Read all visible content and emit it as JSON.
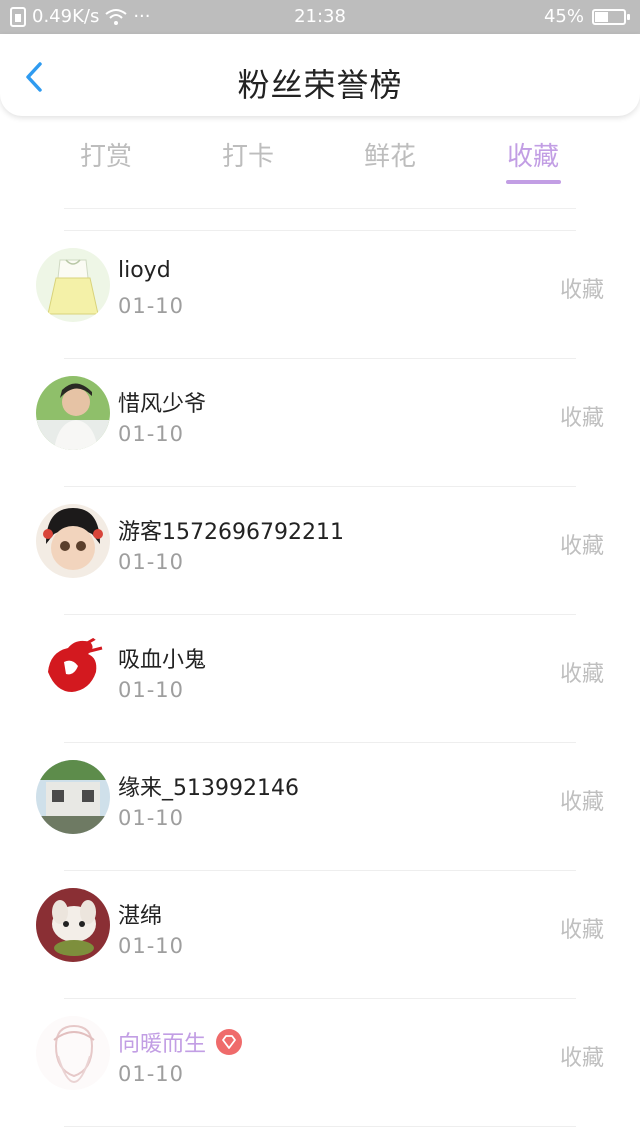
{
  "status_bar": {
    "network": "0.49K/s",
    "dots": "···",
    "time": "21:38",
    "battery": "45%",
    "battery_level": 0.45
  },
  "header": {
    "title": "粉丝荣誉榜"
  },
  "tabs": [
    {
      "label": "打赏"
    },
    {
      "label": "打卡"
    },
    {
      "label": "鲜花"
    },
    {
      "label": "收藏"
    }
  ],
  "active_tab": "收藏",
  "fans": [
    {
      "name": "lioyd",
      "date": "01-10",
      "action": "收藏"
    },
    {
      "name": "惜风少爷",
      "date": "01-10",
      "action": "收藏"
    },
    {
      "name": "游客1572696792211",
      "date": "01-10",
      "action": "收藏"
    },
    {
      "name": "吸血小鬼",
      "date": "01-10",
      "action": "收藏"
    },
    {
      "name": "缘来_513992146",
      "date": "01-10",
      "action": "收藏"
    },
    {
      "name": "湛绵",
      "date": "01-10",
      "action": "收藏"
    },
    {
      "name": "向暖而生",
      "date": "01-10",
      "action": "收藏",
      "vip": true
    }
  ],
  "colors": {
    "accent": "#c29ee4",
    "back_icon": "#2f9bf0",
    "vip_badge": "#ef6b6b"
  }
}
